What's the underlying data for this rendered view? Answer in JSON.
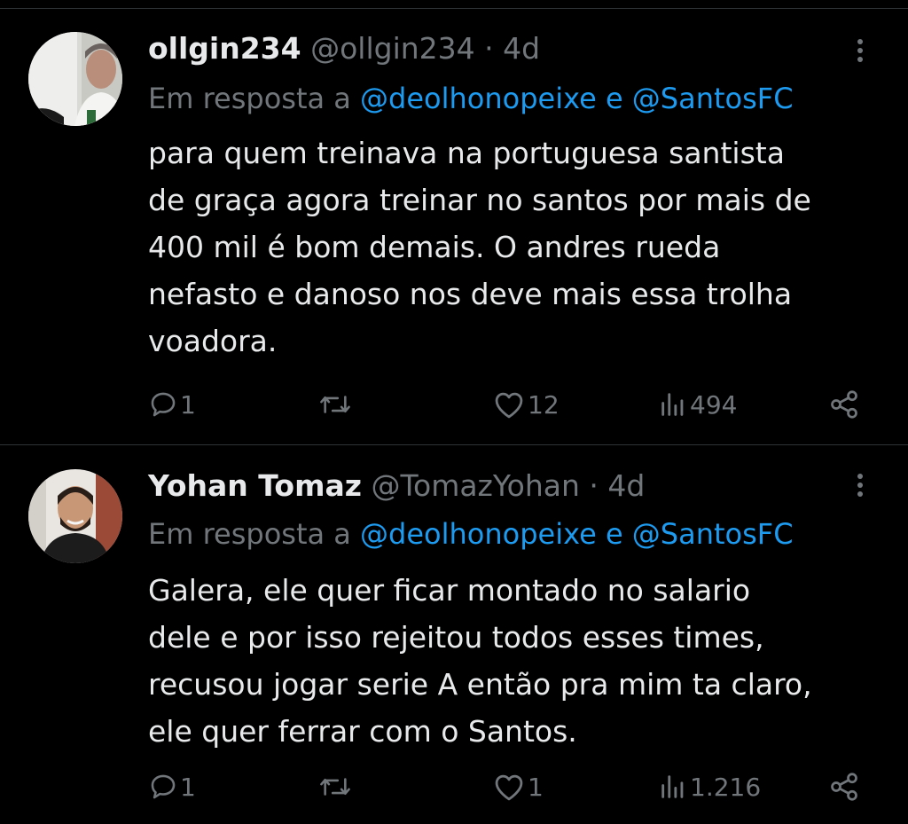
{
  "tweets": [
    {
      "name": "ollgin234",
      "handle": "@ollgin234",
      "separator": "·",
      "time": "4d",
      "reply_prefix": "Em resposta a",
      "mention_1": "@deolhonopeixe",
      "reply_join": "e",
      "mention_2": "@SantosFC",
      "lines": [
        "para quem treinava na portuguesa santista",
        "de graça agora treinar no santos por mais de",
        "400 mil é bom demais. O andres rueda",
        "nefasto e danoso nos deve mais essa trolha",
        "voadora."
      ],
      "replies": "1",
      "retweets": "",
      "likes": "12",
      "views": "494"
    },
    {
      "name": "Yohan Tomaz",
      "handle": "@TomazYohan",
      "separator": "·",
      "time": "4d",
      "reply_prefix": "Em resposta a",
      "mention_1": "@deolhonopeixe",
      "reply_join": "e",
      "mention_2": "@SantosFC",
      "lines": [
        "Galera, ele quer ficar montado no salario",
        "dele e por isso rejeitou todos esses times,",
        "recusou jogar serie A então pra mim ta claro,",
        "ele quer ferrar com o Santos."
      ],
      "replies": "1",
      "retweets": "",
      "likes": "1",
      "views": "1.216"
    }
  ],
  "icons": {
    "reply": "speech-bubble-icon",
    "retweet": "retweet-icon",
    "like": "heart-icon",
    "views": "bar-chart-icon",
    "share": "share-icon",
    "more": "more-dots-icon"
  },
  "colors": {
    "background": "#000000",
    "text": "#e7e9ea",
    "muted": "#71767b",
    "link": "#1d9bf0",
    "divider": "#2f3336"
  }
}
